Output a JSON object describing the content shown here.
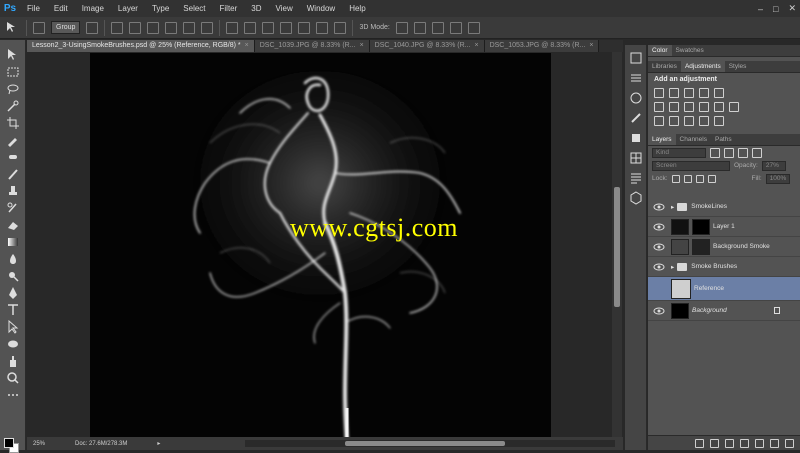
{
  "app": {
    "logo": "Ps"
  },
  "menu": [
    "File",
    "Edit",
    "Image",
    "Layer",
    "Type",
    "Select",
    "Filter",
    "3D",
    "View",
    "Window",
    "Help"
  ],
  "window_controls": {
    "minimize": "–",
    "maximize": "□",
    "close": "✕"
  },
  "options": {
    "auto_select_target": "Group",
    "mode_label": "3D Mode:"
  },
  "tabs": [
    {
      "label": "Lesson2_3-UsingSmokeBrushes.psd @ 25% (Reference, RGB/8) *",
      "active": true
    },
    {
      "label": "DSC_1039.JPG @ 8.33% (R...",
      "active": false
    },
    {
      "label": "DSC_1040.JPG @ 8.33% (R...",
      "active": false
    },
    {
      "label": "DSC_1053.JPG @ 8.33% (R...",
      "active": false
    }
  ],
  "watermark": "www.cgtsj.com",
  "status": {
    "zoom": "25%",
    "doc": "Doc: 27.6M/278.3M"
  },
  "panels": {
    "top_tabs": [
      "Color",
      "Swatches"
    ],
    "adj_tabs": [
      "Libraries",
      "Adjustments",
      "Styles"
    ],
    "adj_title": "Add an adjustment",
    "layer_tabs": [
      "Layers",
      "Channels",
      "Paths"
    ],
    "kind": "Kind",
    "blend_mode": "Screen",
    "opacity_label": "Opacity:",
    "opacity_value": "27%",
    "lock_label": "Lock:",
    "fill_label": "Fill:",
    "fill_value": "100%"
  },
  "layers": [
    {
      "name": "SmokeLines",
      "type": "group"
    },
    {
      "name": "Layer 1",
      "type": "pixel"
    },
    {
      "name": "Background Smoke",
      "type": "pixel"
    },
    {
      "name": "Smoke Brushes",
      "type": "group"
    },
    {
      "name": "Reference",
      "type": "pixel",
      "selected": true
    },
    {
      "name": "Background",
      "type": "background",
      "locked": true
    }
  ],
  "colors": {
    "accent": "#31a8ff",
    "selection": "#6b7fa6",
    "watermark": "#ffff00"
  }
}
